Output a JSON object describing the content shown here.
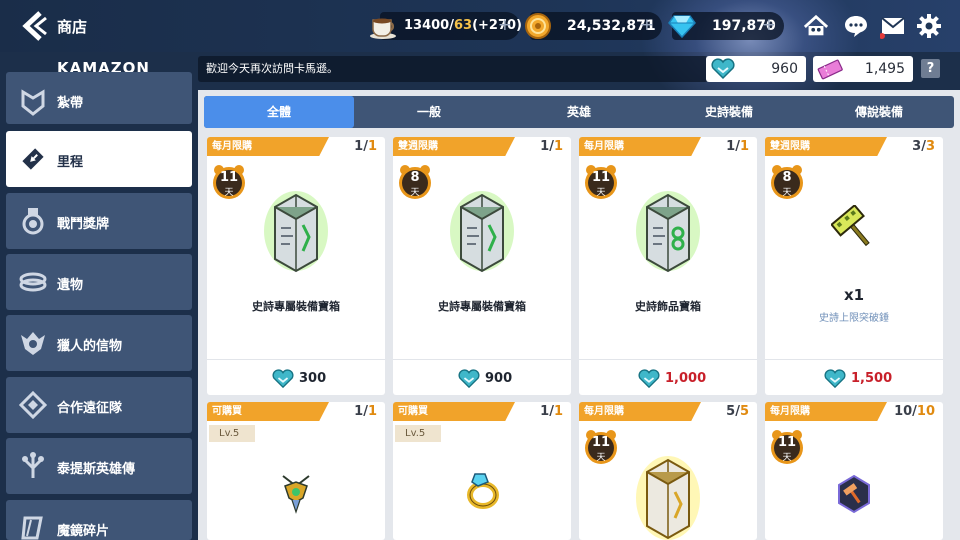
{
  "header": {
    "title": "商店",
    "resources": [
      {
        "icon": "coffee-cup-icon",
        "value": "13400",
        "sep": "/",
        "cap": "63",
        "bonus": "(+270)"
      },
      {
        "icon": "gold-coin-icon",
        "value": "24,532,871"
      },
      {
        "icon": "diamond-icon",
        "value": "197,870"
      }
    ]
  },
  "brand": {
    "logo": "KAMAZON"
  },
  "notice": "歡迎今天再次訪問卡馬遜。",
  "currencies": [
    {
      "icon": "mileage-heart-icon",
      "value": "960"
    },
    {
      "icon": "ticket-icon",
      "value": "1,495"
    }
  ],
  "help_label": "?",
  "sidebar": {
    "items": [
      {
        "label": "紮帶",
        "icon": "badge-icon"
      },
      {
        "label": "里程",
        "icon": "ticket-arrow-icon"
      },
      {
        "label": "戰鬥獎牌",
        "icon": "medal-icon"
      },
      {
        "label": "遺物",
        "icon": "relic-icon"
      },
      {
        "label": "獵人的信物",
        "icon": "hunter-token-icon"
      },
      {
        "label": "合作遠征隊",
        "icon": "coop-icon"
      },
      {
        "label": "泰提斯英雄傳",
        "icon": "tree-icon"
      },
      {
        "label": "魔鏡碎片",
        "icon": "mirror-shard-icon"
      }
    ]
  },
  "tabs": [
    "全體",
    "一般",
    "英雄",
    "史詩裝備",
    "傳說裝備"
  ],
  "cards": [
    {
      "badge": "每月限購",
      "count": "1",
      "max": "1",
      "timer": "11",
      "timer_unit": "天",
      "name": "史詩專屬裝備寶箱",
      "price": "300",
      "price_color": "#1f2530"
    },
    {
      "badge": "雙週限購",
      "count": "1",
      "max": "1",
      "timer": "8",
      "timer_unit": "天",
      "name": "史詩專屬裝備寶箱",
      "price": "900",
      "price_color": "#1f2530"
    },
    {
      "badge": "每月限購",
      "count": "1",
      "max": "1",
      "timer": "11",
      "timer_unit": "天",
      "name": "史詩飾品寶箱",
      "price": "1,000",
      "price_color": "#c8202a"
    },
    {
      "badge": "雙週限購",
      "count": "3",
      "max": "3",
      "timer": "8",
      "timer_unit": "天",
      "qty": "x1",
      "sub": "史詩上限突破錘",
      "price": "1,500",
      "price_color": "#c8202a"
    },
    {
      "badge": "可購買",
      "count": "1",
      "max": "1",
      "level": "Lv.5"
    },
    {
      "badge": "可購買",
      "count": "1",
      "max": "1",
      "level": "Lv.5"
    },
    {
      "badge": "每月限購",
      "count": "5",
      "max": "5",
      "timer": "11",
      "timer_unit": "天"
    },
    {
      "badge": "每月限購",
      "count": "10",
      "max": "10",
      "timer": "11",
      "timer_unit": "天"
    }
  ],
  "colors": {
    "accent": "#4b8eea",
    "badge": "#f1a32a",
    "sidebar": "#3f5576",
    "price_red": "#c8202a",
    "green_box": "#6fd23a",
    "gold_box": "#f1d23a"
  }
}
